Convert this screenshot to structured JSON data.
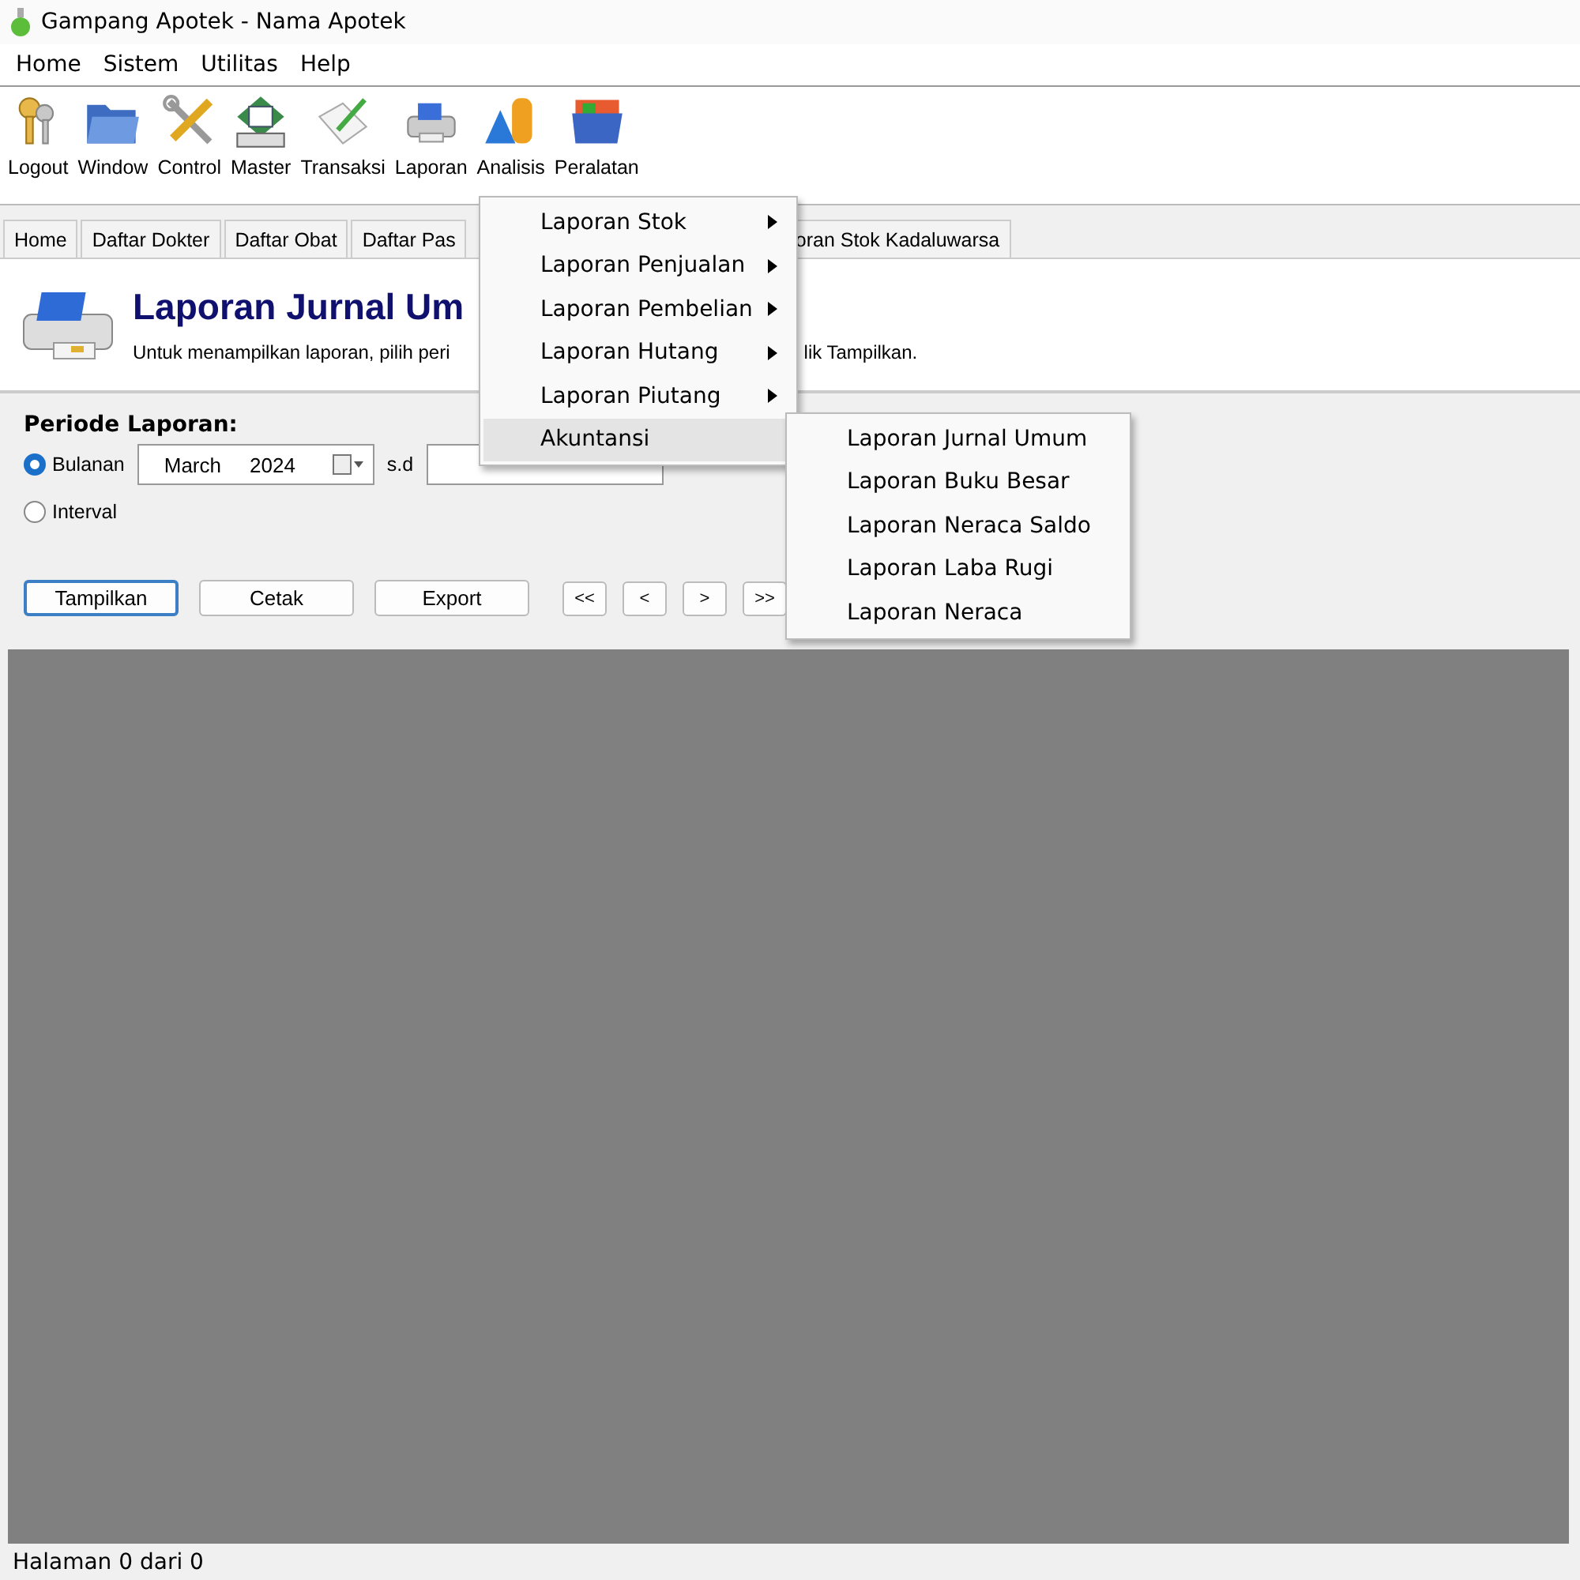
{
  "window": {
    "title": "Gampang Apotek - Nama Apotek"
  },
  "menu_bar": [
    "Home",
    "Sistem",
    "Utilitas",
    "Help"
  ],
  "toolbar": [
    {
      "label": "Logout",
      "kind": "keys"
    },
    {
      "label": "Window",
      "kind": "folder"
    },
    {
      "label": "Control",
      "kind": "tools"
    },
    {
      "label": "Master",
      "kind": "disk"
    },
    {
      "label": "Transaksi",
      "kind": "paper"
    },
    {
      "label": "Laporan",
      "kind": "printer"
    },
    {
      "label": "Analisis",
      "kind": "shapes"
    },
    {
      "label": "Peralatan",
      "kind": "box"
    }
  ],
  "tabs": [
    "Home",
    "Daftar Dokter",
    "Daftar Obat",
    "Daftar Pas",
    "oran Stok Kadaluwarsa"
  ],
  "header": {
    "title": "Laporan Jurnal Um",
    "description": "Untuk menampilkan laporan, pilih peri",
    "description_end": "lik Tampilkan."
  },
  "form": {
    "label": "Periode Laporan:",
    "radios": [
      {
        "label": "Bulanan",
        "selected": true
      },
      {
        "label": "Interval",
        "selected": false
      }
    ],
    "month": "March",
    "year": "2024",
    "until_label": "s.d",
    "buttons": [
      {
        "label": "Tampilkan",
        "focused": true
      },
      {
        "label": "Cetak",
        "focused": false
      },
      {
        "label": "Export",
        "focused": false
      }
    ],
    "nav_buttons": [
      "<<",
      "<",
      ">",
      ">>"
    ]
  },
  "dropdown_menu": {
    "items": [
      {
        "label": "Laporan Stok",
        "submenu": true,
        "selected": false
      },
      {
        "label": "Laporan Penjualan",
        "submenu": true,
        "selected": false
      },
      {
        "label": "Laporan Pembelian",
        "submenu": true,
        "selected": false
      },
      {
        "label": "Laporan Hutang",
        "submenu": true,
        "selected": false
      },
      {
        "label": "Laporan Piutang",
        "submenu": true,
        "selected": false
      },
      {
        "label": "Akuntansi",
        "submenu": false,
        "selected": true
      }
    ]
  },
  "submenu": {
    "items": [
      "Laporan Jurnal Umum",
      "Laporan Buku Besar",
      "Laporan Neraca Saldo",
      "Laporan Laba Rugi",
      "Laporan Neraca"
    ]
  },
  "status_bar": "Halaman 0 dari 0"
}
